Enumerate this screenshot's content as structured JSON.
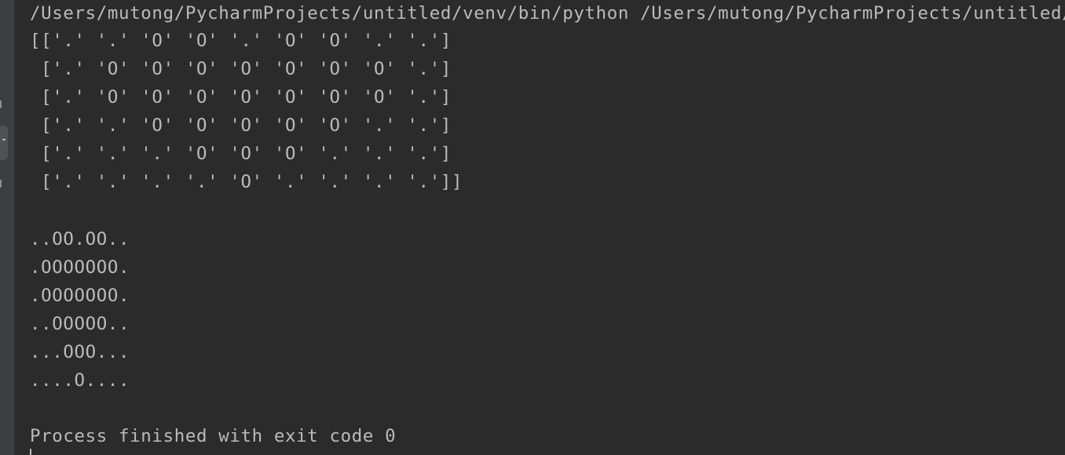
{
  "console": {
    "command": "/Users/mutong/PycharmProjects/untitled/venv/bin/python /Users/mutong/PycharmProjects/untitled/s",
    "array_lines": [
      "[['.' '.' 'O' 'O' '.' 'O' 'O' '.' '.']",
      " ['.' 'O' 'O' 'O' 'O' 'O' 'O' 'O' '.']",
      " ['.' 'O' 'O' 'O' 'O' 'O' 'O' 'O' '.']",
      " ['.' '.' 'O' 'O' 'O' 'O' 'O' '.' '.']",
      " ['.' '.' '.' 'O' 'O' 'O' '.' '.' '.']",
      " ['.' '.' '.' '.' 'O' '.' '.' '.' '.']]"
    ],
    "grid_lines": [
      "..OO.OO..",
      ".OOOOOOO.",
      ".OOOOOOO.",
      "..OOOOO..",
      "...OOO...",
      "....O...."
    ],
    "exit_message": "Process finished with exit code 0"
  },
  "colors": {
    "background": "#2b2b2b",
    "text": "#bbbbbb",
    "gutter": "#3c3f41"
  }
}
